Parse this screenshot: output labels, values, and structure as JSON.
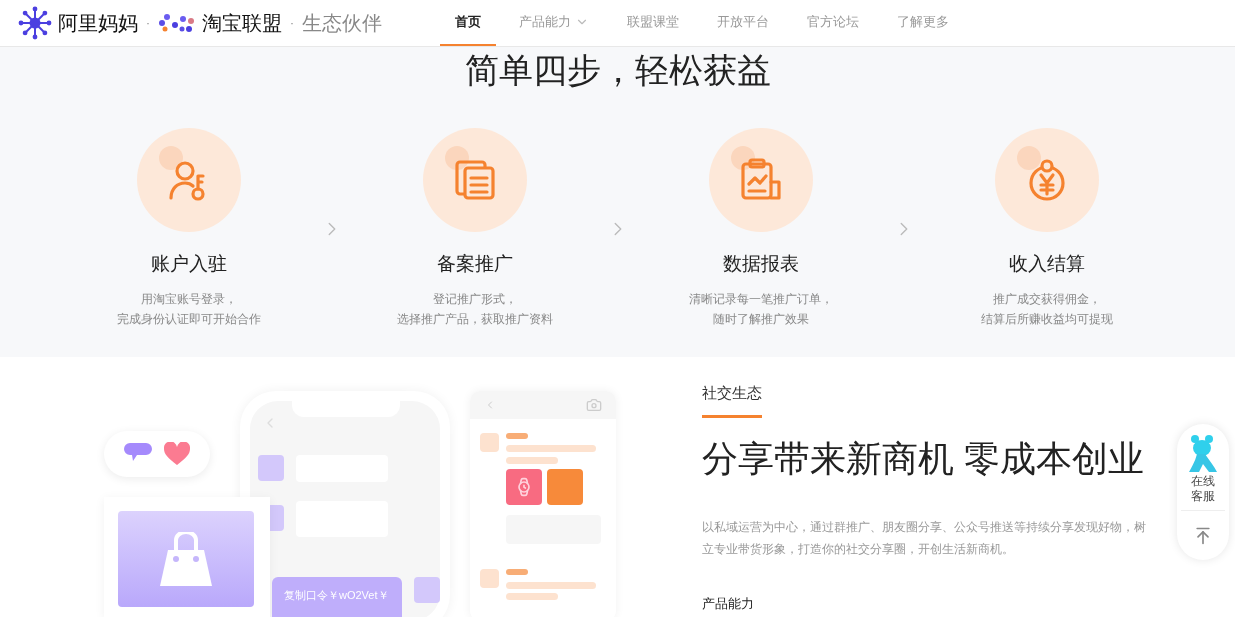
{
  "header": {
    "logo_text": "阿里妈妈",
    "separator_1": "·",
    "brand": "淘宝联盟",
    "separator_2": "·",
    "subtitle": "生态伙伴"
  },
  "nav": [
    {
      "label": "首页",
      "selected": true,
      "has_dropdown": false
    },
    {
      "label": "产品能力",
      "selected": false,
      "has_dropdown": true
    },
    {
      "label": "联盟课堂",
      "selected": false,
      "has_dropdown": false
    },
    {
      "label": "开放平台",
      "selected": false,
      "has_dropdown": false
    },
    {
      "label": "官方论坛",
      "selected": false,
      "has_dropdown": false
    },
    {
      "label": "了解更多",
      "selected": false,
      "has_dropdown": false
    }
  ],
  "steps_section": {
    "title": "简单四步，轻松获益",
    "steps": [
      {
        "kind": "account",
        "title": "账户入驻",
        "description": [
          "用淘宝账号登录，",
          "完成身份认证即可开始合作"
        ]
      },
      {
        "kind": "files",
        "title": "备案推广",
        "description": [
          "登记推广形式，",
          "选择推广产品，获取推广资料"
        ]
      },
      {
        "kind": "report",
        "title": "数据报表",
        "description": [
          "清晰记录每一笔推广订单，",
          "随时了解推广效果"
        ]
      },
      {
        "kind": "income",
        "title": "收入结算",
        "description": [
          "推广成交获得佣金，",
          "结算后所赚收益均可提现"
        ]
      }
    ]
  },
  "feature": {
    "tag": "社交生态",
    "headline": "分享带来新商机 零成本创业",
    "body": "以私域运营为中心，通过群推广、朋友圈分享、公众号推送等持续分享发现好物，树立专业带货形象，打造你的社交分享圈，开创生活新商机。",
    "subheading": "产品能力",
    "illustration": {
      "bubble_text": "复制口令￥wO2Vet￥"
    }
  },
  "float_panel": {
    "service_label": "在线客服"
  }
}
